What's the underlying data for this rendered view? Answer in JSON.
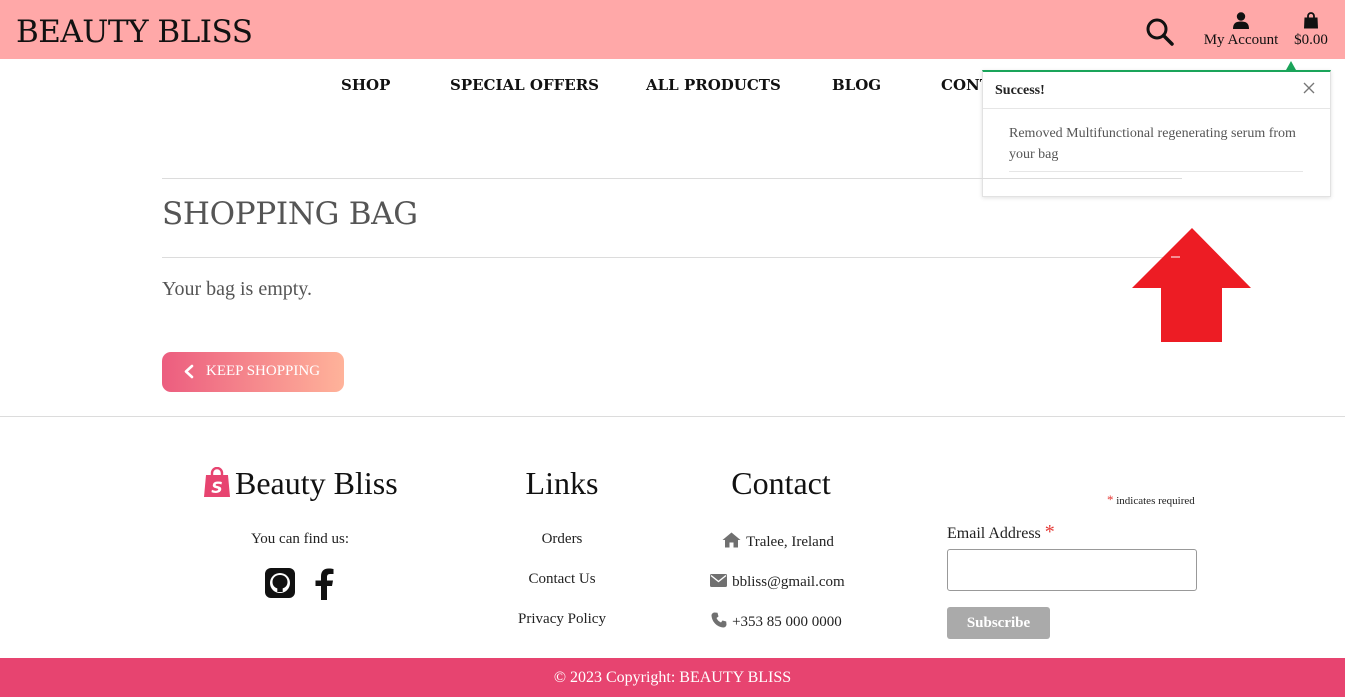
{
  "header": {
    "brand": "BEAUTY BLISS",
    "account_label": "My Account",
    "bag_total": "$0.00"
  },
  "nav": {
    "items": [
      "SHOP",
      "SPECIAL OFFERS",
      "ALL PRODUCTS",
      "BLOG",
      "CONT"
    ]
  },
  "toast": {
    "title": "Success!",
    "message": "Removed Multifunctional regenerating serum from your bag"
  },
  "main": {
    "title": "SHOPPING BAG",
    "empty_message": "Your bag is empty.",
    "keep_shopping_label": "KEEP SHOPPING"
  },
  "footer": {
    "brand_heading": "Beauty Bliss",
    "find_us": "You can find us:",
    "links_heading": "Links",
    "links": [
      "Orders",
      "Contact Us",
      "Privacy Policy"
    ],
    "contact_heading": "Contact",
    "contact": {
      "location": "Tralee, Ireland",
      "email": "bbliss@gmail.com",
      "phone": "+353 85 000 0000"
    },
    "newsletter": {
      "required_star": "*",
      "required_note": "indicates required",
      "email_label": "Email Address",
      "email_value": "",
      "subscribe_label": "Subscribe"
    },
    "copyright": "© 2023 Copyright: BEAUTY BLISS"
  },
  "colors": {
    "header_bg": "#ffa8a8",
    "accent_pink": "#e74470",
    "toast_border": "#1aa45a",
    "annotation_arrow": "#ed1c24"
  }
}
